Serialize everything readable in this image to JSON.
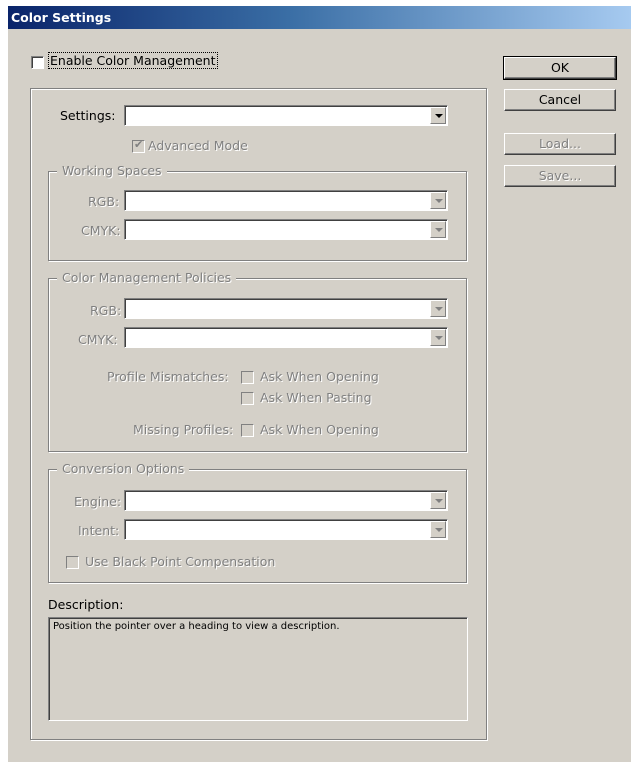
{
  "window": {
    "title": "Color Settings"
  },
  "enable_cm": {
    "label": "Enable Color Management",
    "checked": false
  },
  "buttons": {
    "ok": "OK",
    "cancel": "Cancel",
    "load": "Load...",
    "save": "Save..."
  },
  "settings": {
    "label": "Settings:",
    "value": ""
  },
  "advanced_mode": {
    "label": "Advanced Mode",
    "checked": true
  },
  "working_spaces": {
    "title": "Working Spaces",
    "rgb_label": "RGB:",
    "cmyk_label": "CMYK:"
  },
  "policies": {
    "title": "Color Management Policies",
    "rgb_label": "RGB:",
    "cmyk_label": "CMYK:",
    "profile_mismatches_label": "Profile Mismatches:",
    "ask_opening": "Ask When Opening",
    "ask_pasting": "Ask When Pasting",
    "missing_profiles_label": "Missing Profiles:",
    "ask_opening_missing": "Ask When Opening"
  },
  "conversion": {
    "title": "Conversion Options",
    "engine_label": "Engine:",
    "intent_label": "Intent:",
    "black_point": "Use Black Point Compensation"
  },
  "description": {
    "label": "Description:",
    "text": "Position the pointer over a heading to view a description."
  }
}
